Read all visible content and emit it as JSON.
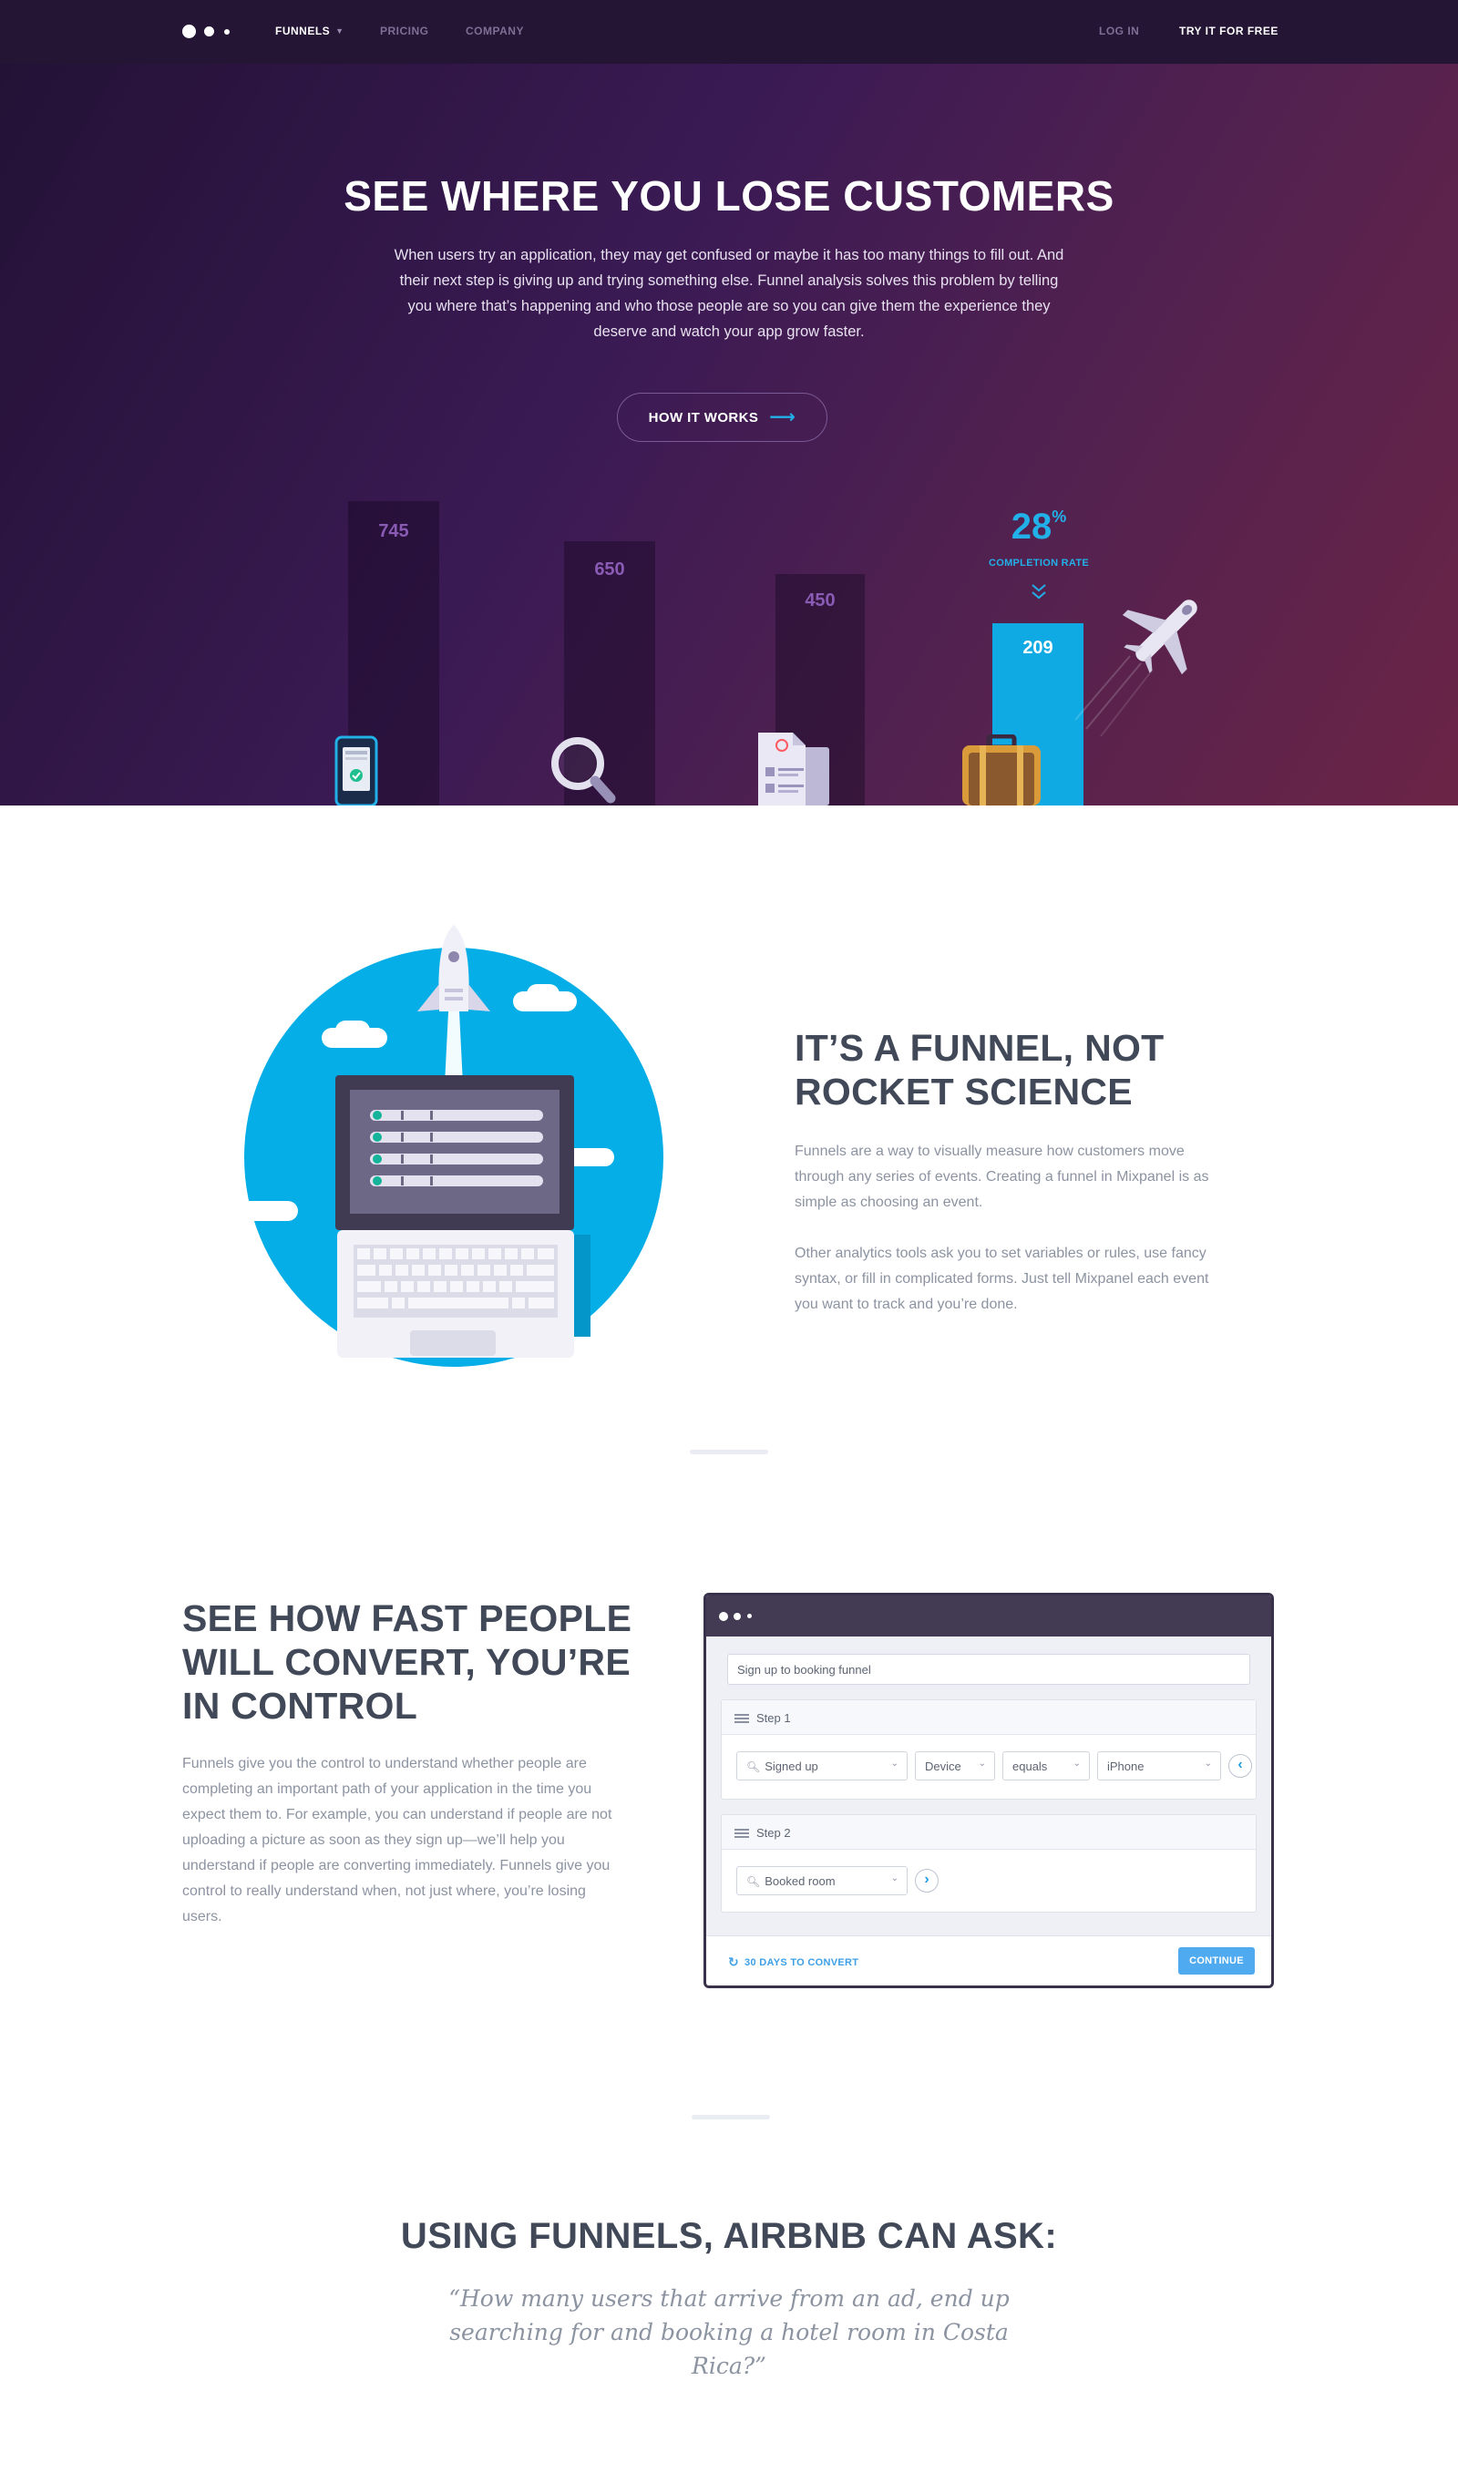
{
  "nav": {
    "links": [
      {
        "label": "FUNNELS",
        "active": true,
        "has_caret": true
      },
      {
        "label": "PRICING"
      },
      {
        "label": "COMPANY"
      }
    ],
    "login": "LOG IN",
    "cta": "TRY IT FOR FREE"
  },
  "hero": {
    "title": "SEE WHERE YOU LOSE CUSTOMERS",
    "description": "When users try an application, they may get confused or maybe it has too many things to fill out. And their next step is giving up and trying something else. Funnel analysis solves this problem by telling you where that’s happening and who those people are so you can give them the experience they deserve and watch your app grow faster.",
    "button_label": "HOW IT WORKS",
    "funnel_values": [
      "745",
      "650",
      "450",
      "209"
    ],
    "completion_pct": "28",
    "completion_pct_symbol": "%",
    "completion_label": "COMPLETION RATE",
    "icons": [
      "phone-icon",
      "magnifier-icon",
      "document-icon",
      "suitcase-icon",
      "airplane-icon"
    ],
    "colors": {
      "accent": "#22b0e8",
      "bg_start": "#231236",
      "bg_end": "#6b2446"
    }
  },
  "section_rocket": {
    "title": "IT’S A FUNNEL, NOT ROCKET SCIENCE",
    "paragraph1": "Funnels are a way to visually measure how customers move through any series of events.  Creating a funnel in Mixpanel is as simple as choosing an event.",
    "paragraph2": "Other analytics tools ask you to set variables or rules, use fancy syntax, or fill in complicated forms. Just tell Mixpanel each event you want to track and you’re done.",
    "illustration_icon": "laptop-rocket-icon"
  },
  "section_control": {
    "title": "SEE HOW FAST PEOPLE WILL CONVERT, YOU’RE IN CONTROL",
    "paragraph": "Funnels give you the control to understand whether people are completing an important path of your application in the time you expect them to. For example, you can understand if people are not uploading a picture as soon as they sign up—we’ll help you understand if people are converting immediately. Funnels give you control to really understand when, not just where, you’re losing users."
  },
  "mock_window": {
    "funnel_name": "Sign up to booking funnel",
    "step1": {
      "label": "Step 1",
      "event": "Signed up",
      "property": "Device",
      "operator": "equals",
      "value": "iPhone",
      "nav_button": "‹"
    },
    "step2": {
      "label": "Step 2",
      "event": "Booked room",
      "nav_button": "›"
    },
    "footer_link": "30 DAYS TO CONVERT",
    "continue_label": "CONTINUE"
  },
  "section_airbnb": {
    "title": "USING FUNNELS, AIRBNB CAN ASK:",
    "quote": "“How many users that arrive from an ad, end up searching for and booking a hotel room in Costa Rica?”"
  }
}
